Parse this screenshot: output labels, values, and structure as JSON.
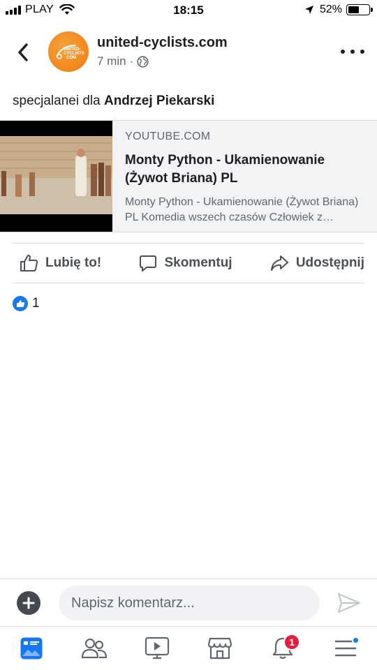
{
  "status_bar": {
    "carrier": "PLAY",
    "time": "18:15",
    "battery": "52%",
    "battery_level": 0.52
  },
  "post": {
    "page_name": "united-cyclists.com",
    "avatar_text": "UNITED-CYCLISTS.COM",
    "time_ago": "7 min",
    "meta_separator": "·",
    "text_prefix": "specjalanei dla",
    "mention": "Andrzej Piekarski"
  },
  "link_card": {
    "domain": "YOUTUBE.COM",
    "title": "Monty Python - Ukamienowanie (Żywot Briana) PL",
    "description": "Monty Python - Ukamienowanie (Żywot Briana) PL Komedia wszech czasów Człowiek z poczuciem humoru."
  },
  "actions": {
    "like": "Lubię to!",
    "comment": "Skomentuj",
    "share": "Udostępnij"
  },
  "reactions": {
    "count": "1"
  },
  "composer": {
    "placeholder": "Napisz komentarz..."
  },
  "tabbar": {
    "notifications_badge": "1",
    "tabs": [
      "news-feed",
      "friends",
      "watch",
      "marketplace",
      "notifications",
      "menu"
    ]
  },
  "colors": {
    "accent": "#1877f2",
    "badge": "#e41e3f",
    "avatar": "#ef7b12"
  }
}
